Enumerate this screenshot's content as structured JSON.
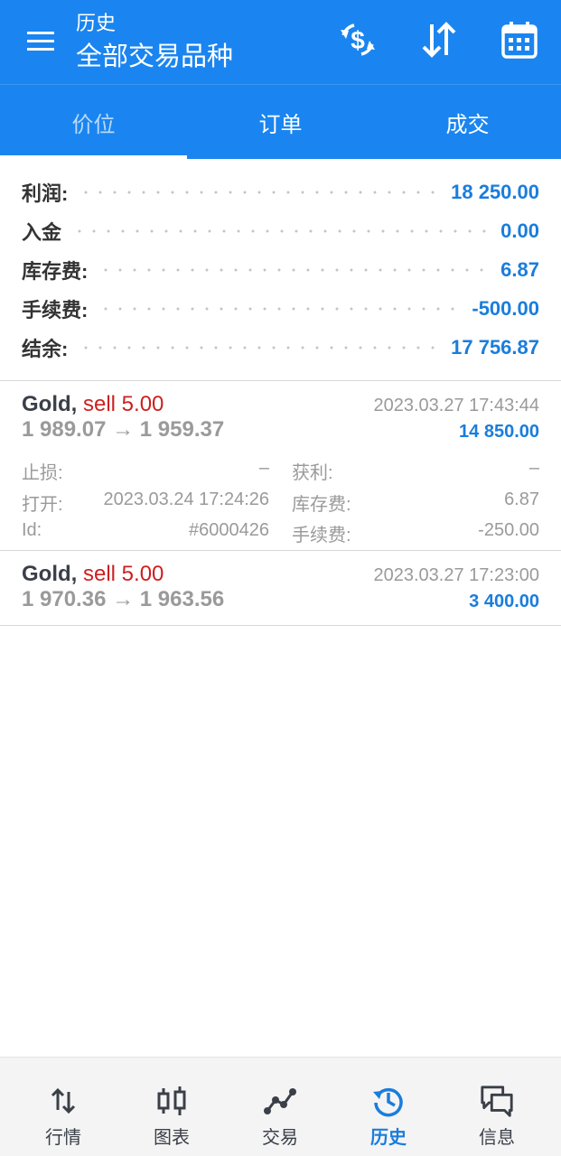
{
  "app_bar": {
    "subtitle": "历史",
    "title": "全部交易品种",
    "icons": [
      "menu-icon",
      "currency-exchange-icon",
      "sort-icon",
      "calendar-icon"
    ]
  },
  "tabs": [
    {
      "label": "价位",
      "active": false
    },
    {
      "label": "订单",
      "active": false
    },
    {
      "label": "成交",
      "active": false
    }
  ],
  "summary": {
    "profit": {
      "label": "利润:",
      "value": "18 250.00"
    },
    "deposit": {
      "label": "入金",
      "value": "0.00"
    },
    "swap": {
      "label": "库存费:",
      "value": "6.87"
    },
    "commission": {
      "label": "手续费:",
      "value": "-500.00"
    },
    "balance": {
      "label": "结余:",
      "value": "17 756.87"
    }
  },
  "deals": [
    {
      "symbol": "Gold,",
      "side": "sell 5.00",
      "time": "2023.03.27 17:43:44",
      "prices": "1 989.07 → 1 959.37",
      "profit": "14 850.00",
      "expanded": true,
      "details": {
        "sl_label": "止损:",
        "sl_value": "–",
        "tp_label": "获利:",
        "tp_value": "–",
        "open_label": "打开:",
        "open_value": "2023.03.24 17:24:26",
        "swap_label": "库存费:",
        "swap_value": "6.87",
        "id_label": "Id:",
        "id_value": "#6000426",
        "commission_label": "手续费:",
        "commission_value": "-250.00"
      }
    },
    {
      "symbol": "Gold,",
      "side": "sell 5.00",
      "time": "2023.03.27 17:23:00",
      "prices": "1 970.36 → 1 963.56",
      "profit": "3 400.00",
      "expanded": false
    }
  ],
  "bottom_nav": [
    {
      "label": "行情",
      "icon": "quotes-arrows-icon",
      "active": false
    },
    {
      "label": "图表",
      "icon": "candlestick-chart-icon",
      "active": false
    },
    {
      "label": "交易",
      "icon": "trade-line-icon",
      "active": false
    },
    {
      "label": "历史",
      "icon": "history-clock-icon",
      "active": true
    },
    {
      "label": "信息",
      "icon": "messages-icon",
      "active": false
    }
  ],
  "colors": {
    "primary": "#1a85f0",
    "profit_blue": "#1a7ddc",
    "sell_red": "#cc2020",
    "muted_gray": "#9a9a9a"
  }
}
